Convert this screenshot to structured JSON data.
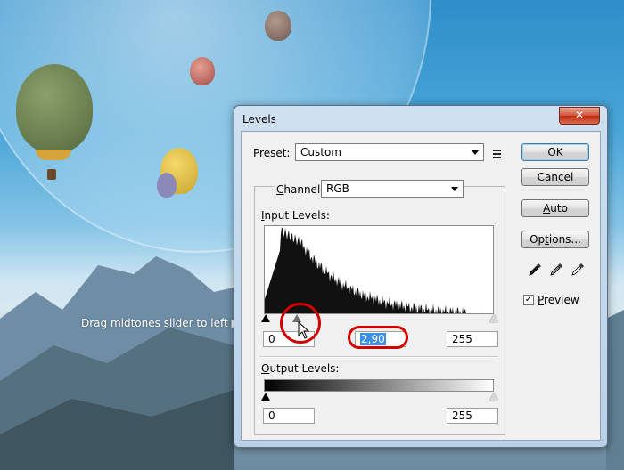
{
  "annotation": {
    "hint": "Drag midtones slider to left"
  },
  "window": {
    "title": "Levels",
    "close_glyph": "✕"
  },
  "preset": {
    "label_pre": "Pr",
    "label_u": "e",
    "label_post": "set:",
    "value": "Custom"
  },
  "channel": {
    "label_u": "C",
    "label_post": "hannel:",
    "value": "RGB"
  },
  "input_levels": {
    "label_u": "I",
    "label_post": "nput Levels:",
    "shadow": "0",
    "midtone": "2,90",
    "highlight": "255"
  },
  "output_levels": {
    "label_u": "O",
    "label_post": "utput Levels:",
    "min": "0",
    "max": "255"
  },
  "buttons": {
    "ok": "OK",
    "cancel": "Cancel",
    "auto_u": "A",
    "auto_post": "uto",
    "options_pre": "Op",
    "options_u": "t",
    "options_post": "ions..."
  },
  "preview": {
    "checked_glyph": "✓",
    "label_u": "P",
    "label_post": "review",
    "checked": true
  },
  "colors": {
    "accent_red": "#d40000",
    "selection": "#3a8ee8"
  }
}
